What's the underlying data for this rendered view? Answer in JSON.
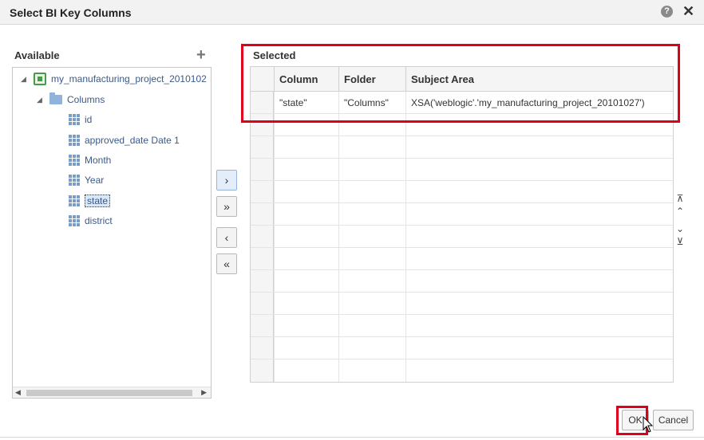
{
  "dialog": {
    "title": "Select BI Key Columns",
    "help_icon": "?",
    "close_icon": "✕"
  },
  "available": {
    "label": "Available",
    "add_icon": "+",
    "tree": {
      "project": "my_manufacturing_project_2010102",
      "folder": "Columns",
      "columns": [
        "id",
        "approved_date Date 1",
        "Month",
        "Year",
        "state",
        "district"
      ],
      "selected_column": "state"
    }
  },
  "shuttle": {
    "move": "›",
    "move_all": "»",
    "remove": "‹",
    "remove_all": "«"
  },
  "selected": {
    "label": "Selected",
    "headers": [
      "Column",
      "Folder",
      "Subject Area"
    ],
    "rows": [
      {
        "column": "\"state\"",
        "folder": "\"Columns\"",
        "subject_area": "XSA('weblogic'.'my_manufacturing_project_20101027')"
      }
    ]
  },
  "reorder": {
    "top": "⊼",
    "up": "⌃",
    "down": "⌄",
    "bottom": "⊻"
  },
  "buttons": {
    "ok": "OK",
    "cancel": "Cancel"
  },
  "colors": {
    "highlight_red": "#e0001a",
    "link_blue": "#3a5a8a"
  }
}
